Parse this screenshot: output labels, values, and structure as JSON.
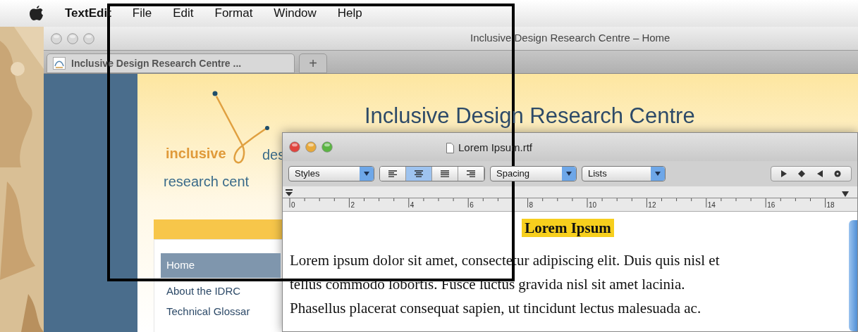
{
  "menu_bar": {
    "app": "TextEdit",
    "items": [
      "File",
      "Edit",
      "Format",
      "Window",
      "Help"
    ]
  },
  "browser": {
    "title": "Inclusive Design Research Centre – Home",
    "tabs": [
      {
        "label": "Inclusive Design Research Centre ...",
        "selected": true
      }
    ],
    "new_tab": "+",
    "page": {
      "logo": {
        "word_1": "inclusive",
        "word_2": "des",
        "word_3": "research cent"
      },
      "heading": "Inclusive Design Research Centre",
      "nav": [
        {
          "label": "Home",
          "selected": true
        },
        {
          "label": "About the IDRC",
          "selected": false
        },
        {
          "label": "Technical Glossar",
          "selected": false
        }
      ]
    }
  },
  "textedit": {
    "title": "Lorem Ipsum.rtf",
    "styles": "Styles",
    "alignments": [
      {
        "kind": "left",
        "selected": false
      },
      {
        "kind": "center",
        "selected": true
      },
      {
        "kind": "justify",
        "selected": false
      },
      {
        "kind": "right",
        "selected": false
      }
    ],
    "spacing": "Spacing",
    "lists": "Lists",
    "ruler": [
      "0",
      "2",
      "4",
      "6",
      "8",
      "10",
      "12",
      "14",
      "16",
      "18"
    ],
    "heading": "Lorem Ipsum",
    "lines": [
      "Lorem ipsum dolor sit amet, consectetur adipiscing elit. Duis quis nisl et",
      "tellus commodo lobortis. Fusce luctus gravida nisl sit amet lacinia.",
      "Phasellus placerat consequat sapien, ut tincidunt lectus malesuada ac."
    ]
  }
}
